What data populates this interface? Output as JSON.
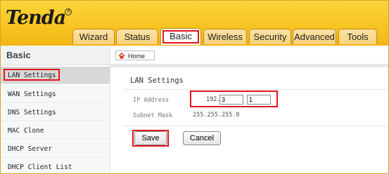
{
  "brand": {
    "logo_text": "Tenda",
    "registered_mark": "R"
  },
  "tabs": [
    {
      "label": "Wizard"
    },
    {
      "label": "Status"
    },
    {
      "label": "Basic"
    },
    {
      "label": "Wireless"
    },
    {
      "label": "Security"
    },
    {
      "label": "Advanced"
    },
    {
      "label": "Tools"
    }
  ],
  "active_tab": "Basic",
  "sidebar": {
    "title": "Basic",
    "items": [
      {
        "label": "LAN Settings"
      },
      {
        "label": "WAN Settings"
      },
      {
        "label": "DNS Settings"
      },
      {
        "label": "MAC Clone"
      },
      {
        "label": "DHCP Server"
      },
      {
        "label": "DHCP Client List"
      }
    ],
    "active_item": "LAN Settings"
  },
  "breadcrumb": {
    "home_label": "Home"
  },
  "lan_settings": {
    "title": "LAN Settings",
    "ip_address_label": "IP Address",
    "ip_prefix": "192.168.",
    "ip_octet3": "3",
    "ip_separator": ".",
    "ip_octet4": "1",
    "subnet_mask_label": "Subnet Mask",
    "subnet_mask_value": "255.255.255.0"
  },
  "buttons": {
    "save": "Save",
    "cancel": "Cancel"
  },
  "colors": {
    "header_yellow": "#f7c522",
    "highlight_red": "#e0141c",
    "tab_border": "#c48a12"
  }
}
